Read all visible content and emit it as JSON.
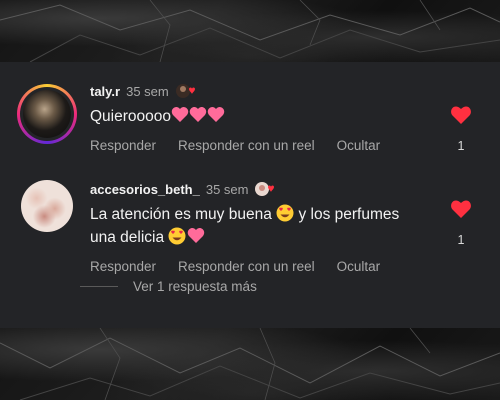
{
  "comments": [
    {
      "username": "taly.r",
      "time": "35 sem",
      "text": "Quierooooo",
      "likes": "1",
      "avatar_icon": "user-avatar-photo",
      "heart_color": "#ff3040"
    },
    {
      "username": "accesorios_beth_",
      "time": "35 sem",
      "text_part1": "La atención es muy buena",
      "text_part2": "y los perfumes",
      "text_part3": "una  delicia",
      "likes": "1",
      "avatar_icon": "user-avatar-photo",
      "heart_color": "#ff3040"
    }
  ],
  "actions": {
    "reply": "Responder",
    "reply_reel": "Responder con un reel",
    "hide": "Ocultar"
  },
  "view_replies": "Ver 1 respuesta más"
}
